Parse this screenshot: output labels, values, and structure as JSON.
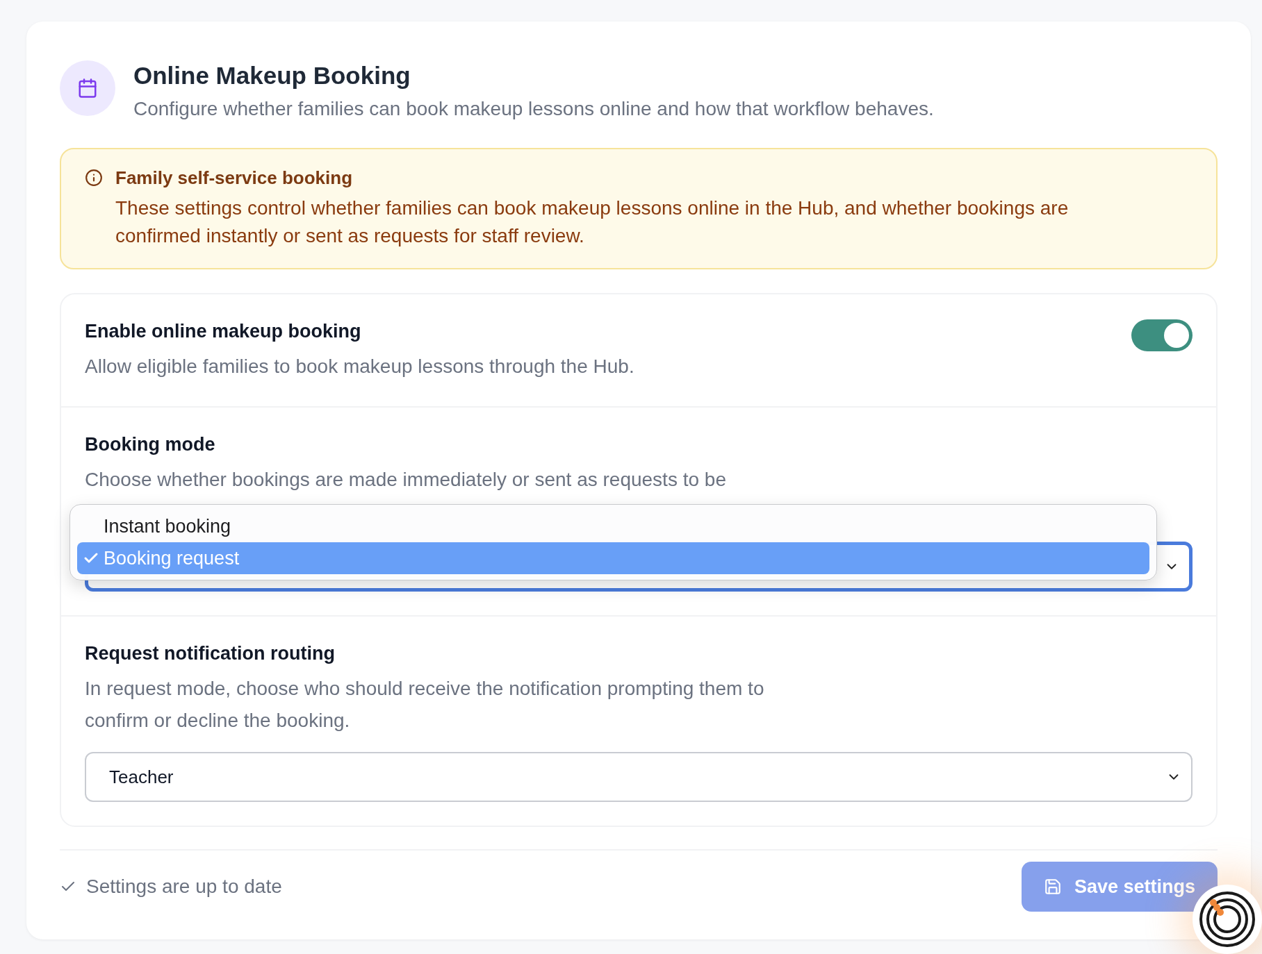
{
  "header": {
    "title": "Online Makeup Booking",
    "subtitle": "Configure whether families can book makeup lessons online and how that workflow behaves."
  },
  "notice": {
    "title": "Family self-service booking",
    "text": "These settings control whether families can book makeup lessons online in the Hub, and whether bookings are confirmed instantly or sent as requests for staff review."
  },
  "settings": [
    {
      "kind": "toggle",
      "label": "Enable online makeup booking",
      "description": "Allow eligible families to book makeup lessons through the Hub.",
      "on": true
    },
    {
      "kind": "select",
      "label": "Booking mode",
      "description": "Choose whether bookings are made immediately or sent as requests to be",
      "open": true,
      "focused": true,
      "options": [
        {
          "label": "Instant booking",
          "selected": false
        },
        {
          "label": "Booking request",
          "selected": true
        }
      ]
    },
    {
      "kind": "select",
      "label": "Request notification routing",
      "description": "In request mode, choose who should receive the notification prompting them to confirm or decline the booking.",
      "open": false,
      "focused": false,
      "value": "Teacher"
    }
  ],
  "footer": {
    "status": "Settings are up to date",
    "save_button": {
      "label": "Save settings",
      "disabled": true
    }
  }
}
